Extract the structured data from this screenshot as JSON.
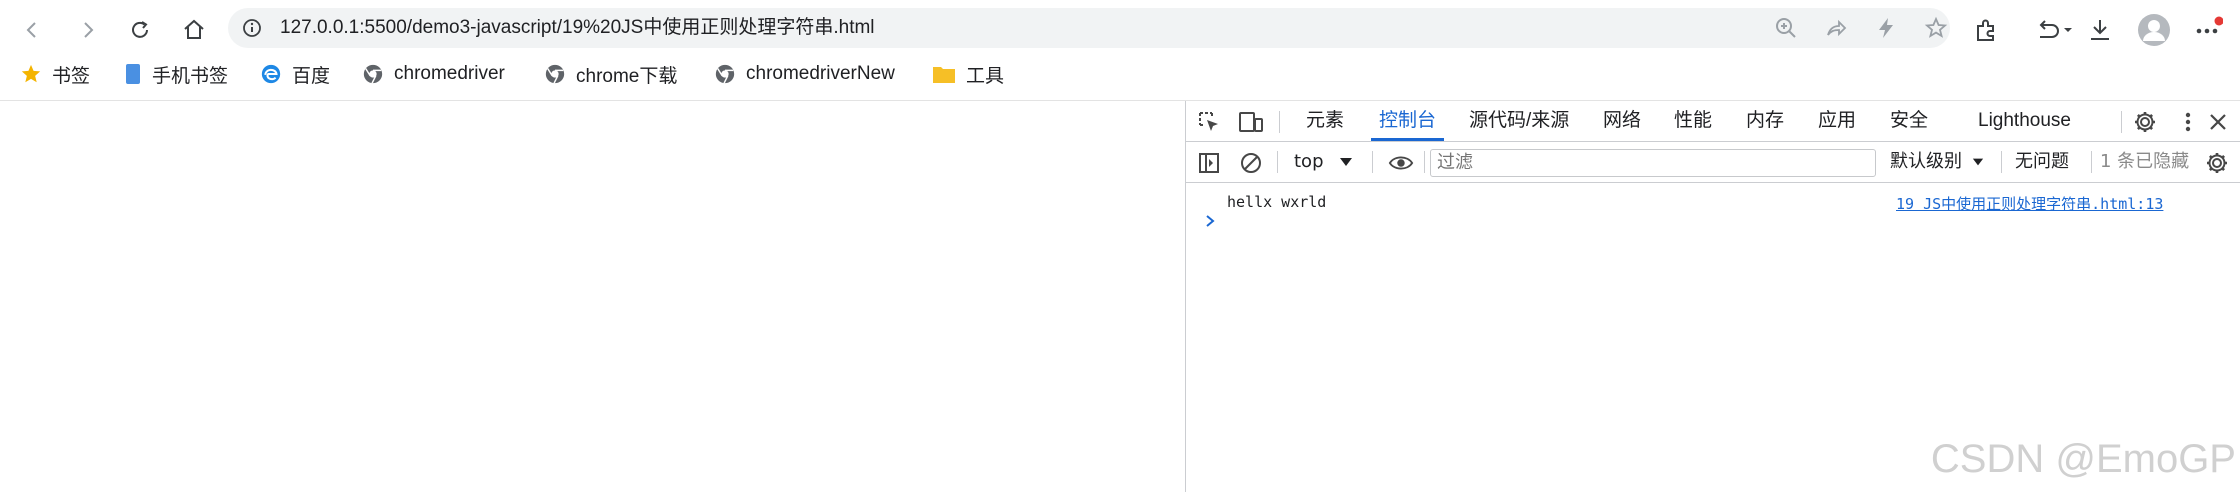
{
  "browser": {
    "url": "127.0.0.1:5500/demo3-javascript/19%20JS中使用正则处理字符串.html",
    "bookmarks": [
      {
        "label": "书签",
        "icon": "star-icon"
      },
      {
        "label": "手机书签",
        "icon": "phone-bookmark-icon"
      },
      {
        "label": "百度",
        "icon": "edge-logo-icon"
      },
      {
        "label": "chromedriver",
        "icon": "chrome-site-icon"
      },
      {
        "label": "chrome下载",
        "icon": "chrome-site-icon"
      },
      {
        "label": "chromedriverNew",
        "icon": "chrome-site-icon"
      },
      {
        "label": "工具",
        "icon": "folder-icon"
      }
    ]
  },
  "devtools": {
    "tabs": [
      "元素",
      "控制台",
      "源代码/来源",
      "网络",
      "性能",
      "内存",
      "应用",
      "安全",
      "Lighthouse"
    ],
    "active_tab": "控制台",
    "toolbar": {
      "context": "top",
      "filter_placeholder": "过滤",
      "levels": "默认级别",
      "issues": "无问题",
      "hidden": "1 条已隐藏"
    },
    "console": {
      "message": "hellx wxrld",
      "source": "19 JS中使用正则处理字符串.html:13"
    }
  },
  "watermark": "CSDN @EmoGP",
  "colors": {
    "accent": "#1a67d2",
    "notify_dot": "#e53935"
  }
}
